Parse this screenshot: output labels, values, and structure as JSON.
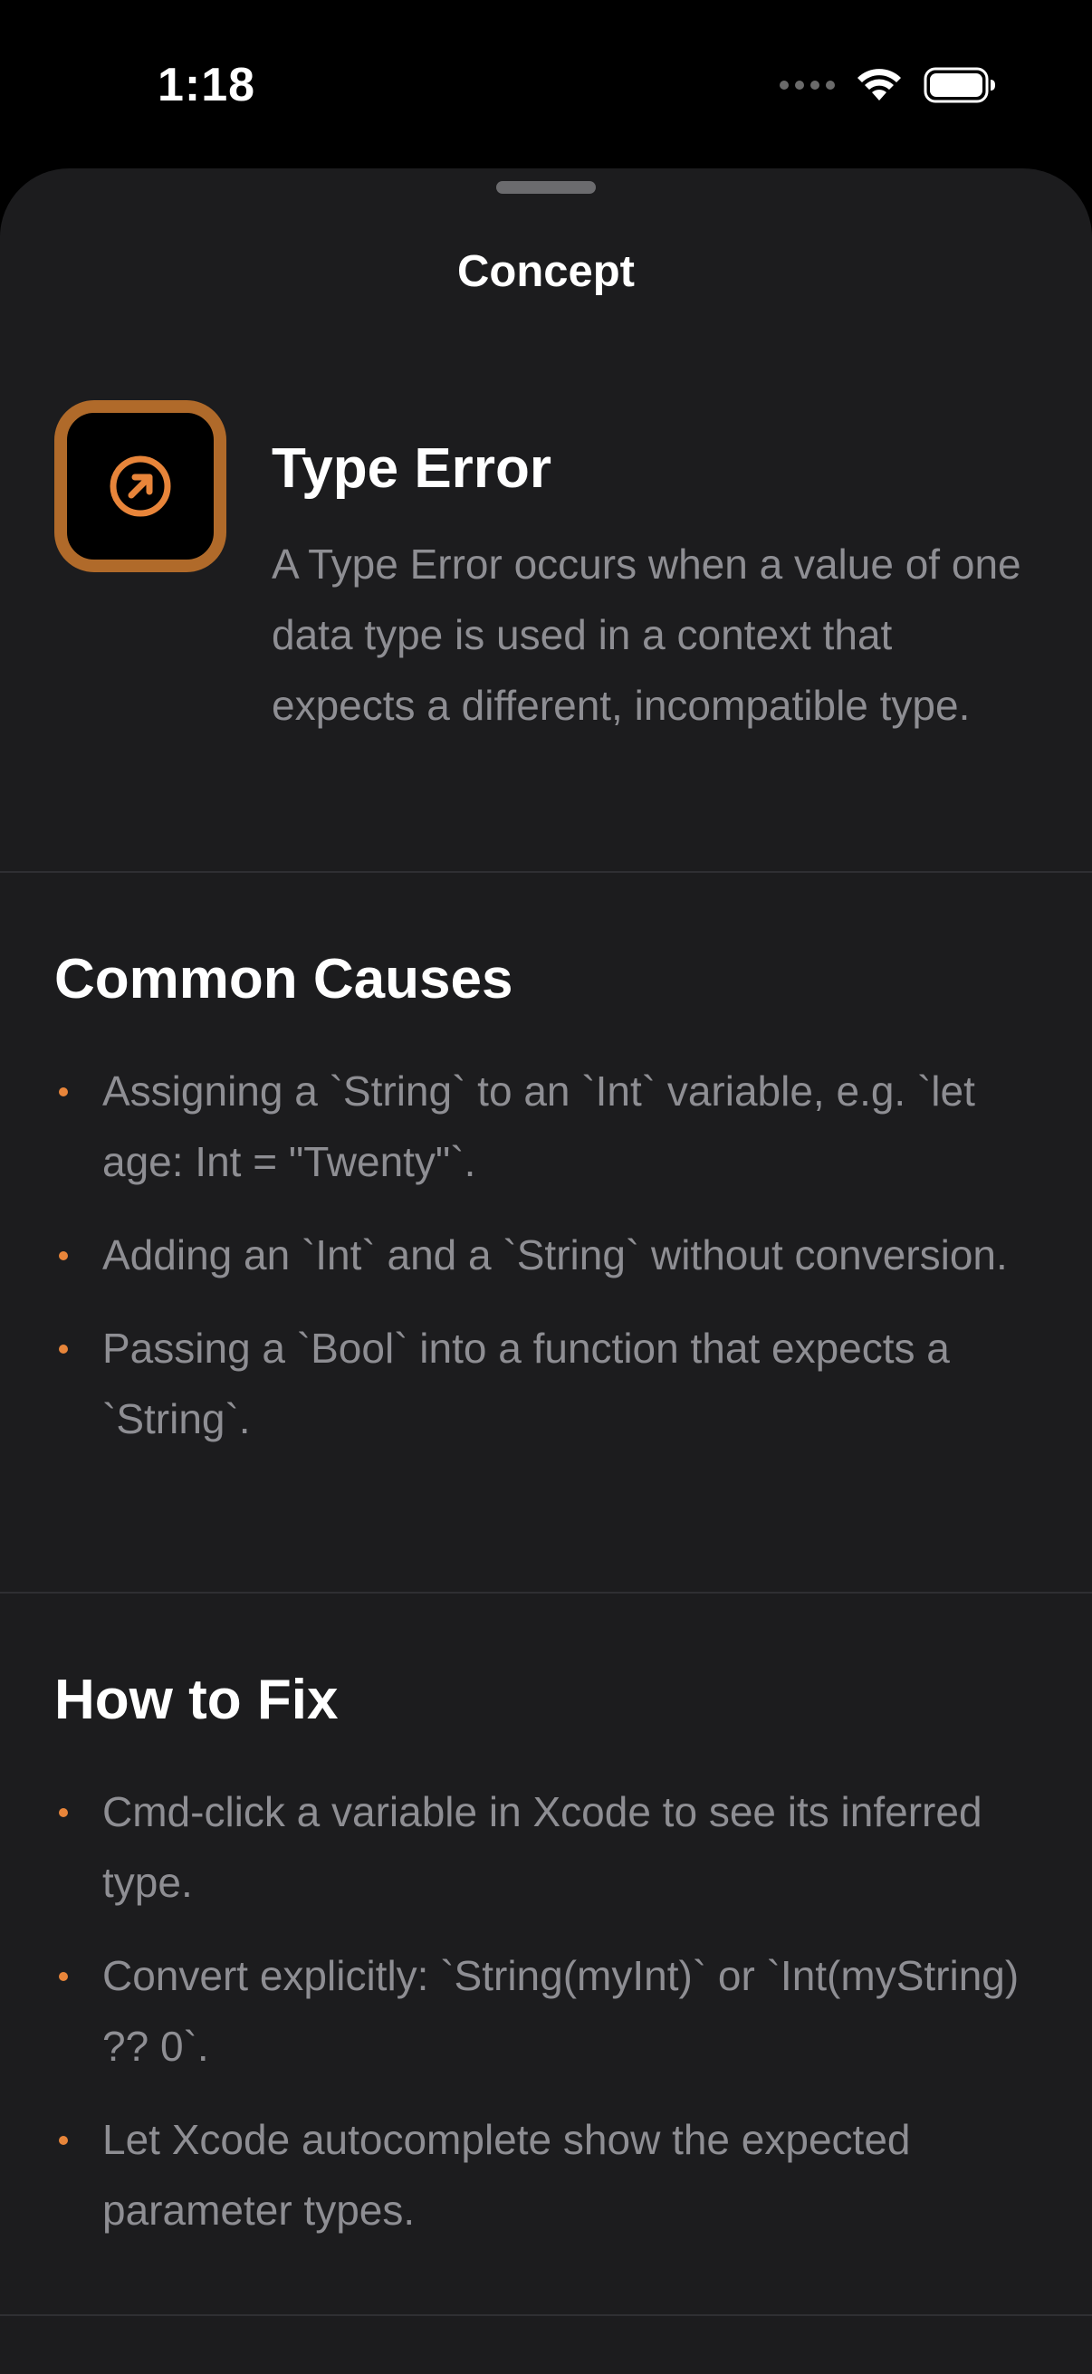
{
  "status_bar": {
    "time": "1:18"
  },
  "sheet": {
    "title": "Concept"
  },
  "concept": {
    "icon": "arrow-up-right-circle-icon",
    "accent_color": "#e8853a",
    "title": "Type Error",
    "description": "A Type Error occurs when a value of one data type is used in a context that expects a different, incompatible type."
  },
  "common_causes": {
    "title": "Common Causes",
    "items": [
      "Assigning a `String` to an `Int` variable, e.g. `let age: Int = \"Twenty\"`.",
      "Adding an `Int` and a `String` without conversion.",
      "Passing a `Bool` into a function that expects a `String`."
    ]
  },
  "how_to_fix": {
    "title": "How to Fix",
    "items": [
      "Cmd-click a variable in Xcode to see its inferred type.",
      "Convert explicitly: `String(myInt)` or `Int(myString) ?? 0`.",
      "Let Xcode autocomplete show the expected parameter types."
    ]
  }
}
